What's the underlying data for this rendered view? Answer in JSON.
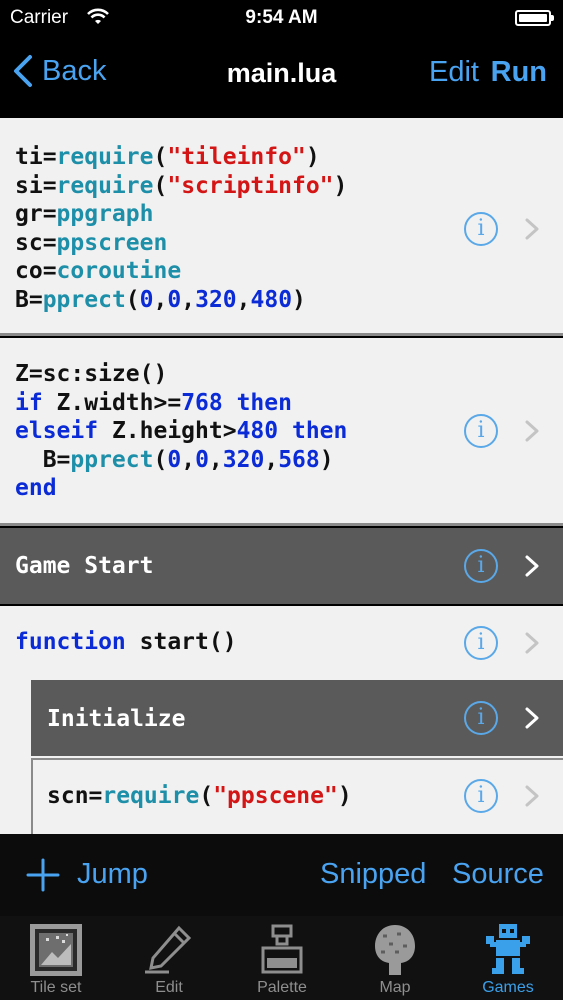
{
  "status": {
    "carrier": "Carrier",
    "time": "9:54 AM",
    "battery_level": 1.0
  },
  "nav": {
    "back_label": "Back",
    "title": "main.lua",
    "edit_label": "Edit",
    "run_label": "Run"
  },
  "blocks": {
    "b1": {
      "l1": {
        "a": "ti=",
        "b": "require",
        "c": "(",
        "d": "\"tileinfo\"",
        "e": ")"
      },
      "l2": {
        "a": "si=",
        "b": "require",
        "c": "(",
        "d": "\"scriptinfo\"",
        "e": ")"
      },
      "l3": {
        "a": "gr=",
        "b": "ppgraph"
      },
      "l4": {
        "a": "sc=",
        "b": "ppscreen"
      },
      "l5": {
        "a": "co=",
        "b": "coroutine"
      },
      "l6": {
        "a": "B=",
        "b": "pprect",
        "c": "(",
        "n1": "0",
        "s1": ",",
        "n2": "0",
        "s2": ",",
        "n3": "320",
        "s3": ",",
        "n4": "480",
        "e": ")"
      }
    },
    "b2": {
      "l1": {
        "a": "Z=sc:size()"
      },
      "l2": {
        "k1": "if",
        "a": " Z.width>=",
        "n": "768",
        "k2": " then"
      },
      "l3": {
        "k1": "elseif",
        "a": " Z.height>",
        "n": "480",
        "k2": " then"
      },
      "l4": {
        "a": "  B=",
        "b": "pprect",
        "c": "(",
        "n1": "0",
        "s1": ",",
        "n2": "0",
        "s2": ",",
        "n3": "320",
        "s3": ",",
        "n4": "568",
        "e": ")"
      },
      "l5": {
        "k1": "end"
      }
    },
    "b3": {
      "label": "Game Start"
    },
    "b4": {
      "k1": "function",
      "a": " start()"
    },
    "b5": {
      "label": "Initialize"
    },
    "b6": {
      "a": "scn=",
      "b": "require",
      "c": "(",
      "d": "\"ppscene\"",
      "e": ")"
    }
  },
  "toolbar": {
    "jump_label": "Jump",
    "snipped_label": "Snipped",
    "source_label": "Source"
  },
  "tabs": [
    {
      "label": "Tile set",
      "icon": "tileset-icon"
    },
    {
      "label": "Edit",
      "icon": "pencil-icon"
    },
    {
      "label": "Palette",
      "icon": "ink-bottle-icon"
    },
    {
      "label": "Map",
      "icon": "tree-icon"
    },
    {
      "label": "Games",
      "icon": "robot-icon",
      "active": true
    }
  ],
  "colors": {
    "accent": "#4aa3f0",
    "keyword": "#0a2bd6",
    "function": "#1e8fa8",
    "string": "#d41515",
    "dark_row": "#5a5a5a",
    "light_row": "#f1f1f1"
  }
}
